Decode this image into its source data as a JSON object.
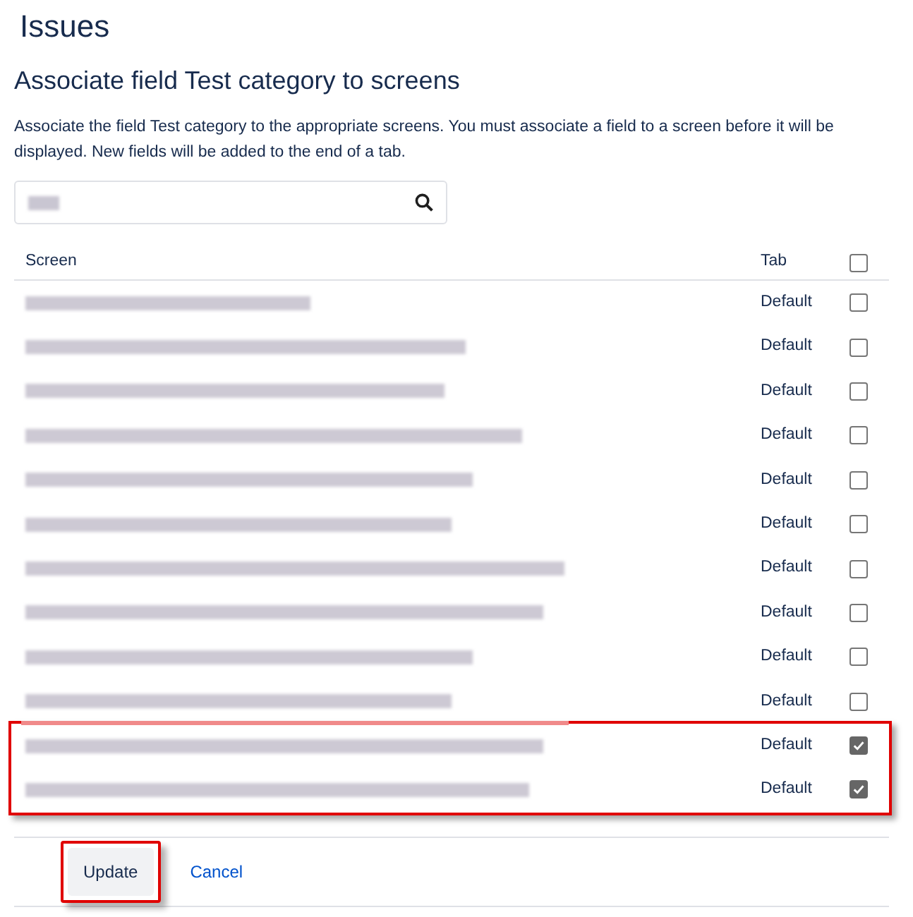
{
  "page": {
    "title": "Issues"
  },
  "heading": "Associate field Test category to screens",
  "description": "Associate the field Test category to the appropriate screens. You must associate a field to a screen before it will be displayed. New fields will be added to the end of a tab.",
  "table": {
    "columns": [
      "Screen",
      "Tab"
    ],
    "select_all": {
      "checked": false
    },
    "rows": [
      {
        "tab": "Default",
        "checked": false,
        "highlighted": false
      },
      {
        "tab": "Default",
        "checked": false,
        "highlighted": false
      },
      {
        "tab": "Default",
        "checked": false,
        "highlighted": false
      },
      {
        "tab": "Default",
        "checked": false,
        "highlighted": false
      },
      {
        "tab": "Default",
        "checked": false,
        "highlighted": false
      },
      {
        "tab": "Default",
        "checked": false,
        "highlighted": false
      },
      {
        "tab": "Default",
        "checked": false,
        "highlighted": false
      },
      {
        "tab": "Default",
        "checked": false,
        "highlighted": false
      },
      {
        "tab": "Default",
        "checked": false,
        "highlighted": false
      },
      {
        "tab": "Default",
        "checked": false,
        "highlighted": false
      },
      {
        "tab": "Default",
        "checked": true,
        "highlighted": true
      },
      {
        "tab": "Default",
        "checked": true,
        "highlighted": true
      }
    ]
  },
  "actions": [
    {
      "label": "Update",
      "kind": "button",
      "highlighted": true
    },
    {
      "label": "Cancel",
      "kind": "link",
      "highlighted": false
    }
  ]
}
